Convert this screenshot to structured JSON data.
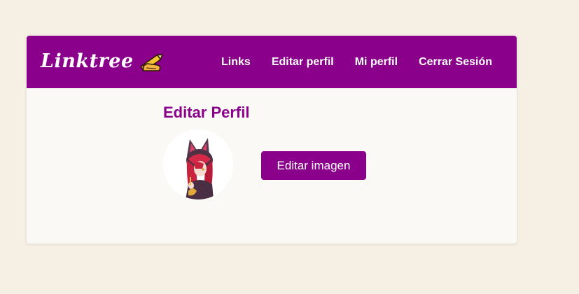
{
  "navbar": {
    "brand": "Linktree",
    "brand_icon": "writing-hand-icon",
    "links": [
      {
        "label": "Links"
      },
      {
        "label": "Editar perfil"
      },
      {
        "label": "Mi perfil"
      },
      {
        "label": "Cerrar Sesión"
      }
    ]
  },
  "main": {
    "title": "Editar Perfil",
    "avatar_icon": "anime-character-avatar",
    "edit_image_button": "Editar imagen"
  },
  "colors": {
    "brand_purple": "#8a008b",
    "page_background": "#f6efe3",
    "card_background": "#fbf9f5",
    "text_on_brand": "#ffffff"
  }
}
